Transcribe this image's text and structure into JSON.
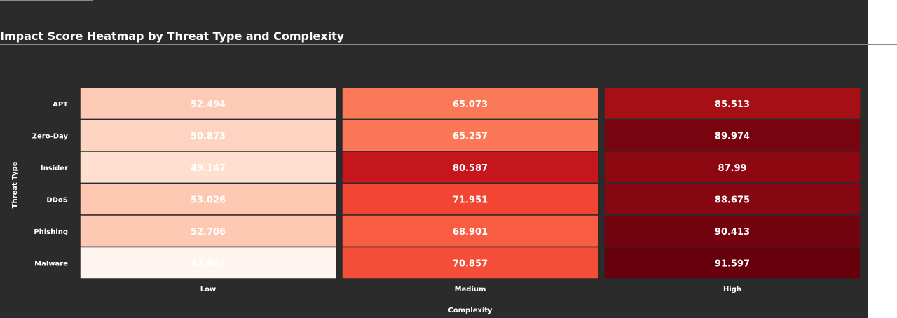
{
  "title": "Impact Score Heatmap by Threat Type and Complexity",
  "chart_data": {
    "type": "heatmap",
    "title": "Impact Score Heatmap by Threat Type and Complexity",
    "xlabel": "Complexity",
    "ylabel": "Threat Type",
    "x_categories": [
      "Low",
      "Medium",
      "High"
    ],
    "y_categories": [
      "APT",
      "Zero-Day",
      "Insider",
      "DDoS",
      "Phishing",
      "Malware"
    ],
    "values": [
      [
        52.494,
        65.073,
        85.513
      ],
      [
        50.873,
        65.257,
        89.974
      ],
      [
        49.147,
        80.587,
        87.99
      ],
      [
        53.026,
        71.951,
        88.675
      ],
      [
        52.706,
        68.901,
        90.413
      ],
      [
        42.803,
        70.857,
        91.597
      ]
    ],
    "colorscale": "Reds"
  }
}
